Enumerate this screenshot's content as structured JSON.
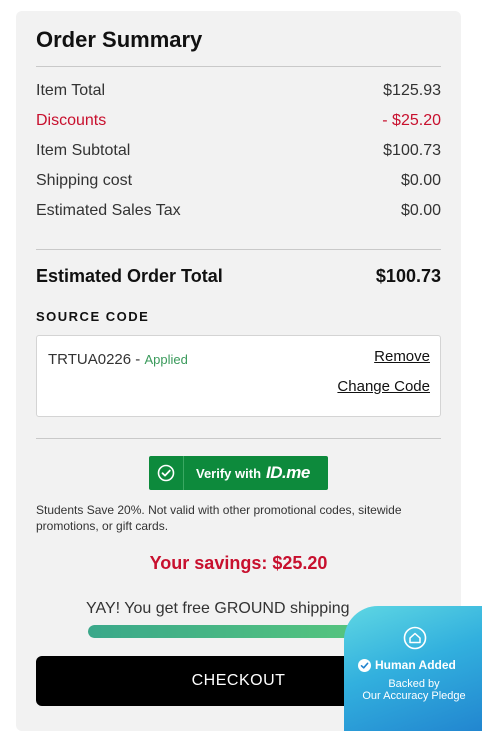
{
  "summary": {
    "title": "Order Summary",
    "rows": [
      {
        "label": "Item Total",
        "value": "$125.93"
      },
      {
        "label": "Discounts",
        "value": "- $25.20"
      },
      {
        "label": "Item Subtotal",
        "value": "$100.73"
      },
      {
        "label": "Shipping cost",
        "value": "$0.00"
      },
      {
        "label": "Estimated Sales Tax",
        "value": "$0.00"
      }
    ],
    "total_label": "Estimated Order Total",
    "total_value": "$100.73"
  },
  "source_code": {
    "heading": "SOURCE CODE",
    "code": "TRTUA0226",
    "separator": " - ",
    "status": "Applied",
    "remove_label": "Remove",
    "change_label": "Change Code"
  },
  "idme": {
    "label": "Verify with",
    "brand": "ID.me",
    "icon": "check-circle-icon"
  },
  "student_note": "Students Save 20%. Not valid with other promotional codes, sitewide promotions, or gift cards.",
  "savings_text": "Your savings: $25.20",
  "shipping": {
    "message": "YAY! You get free GROUND shipping",
    "progress": 1.0
  },
  "checkout_label": "CHECKOUT",
  "badge": {
    "title": "Human Added",
    "line1": "Backed by",
    "line2": "Our Accuracy Pledge",
    "icon": "home-shield-icon"
  },
  "colors": {
    "accent_red": "#c8102e",
    "idme_green": "#0d8a3c",
    "applied_green": "#3a9a5b",
    "checkout_black": "#000000",
    "badge_blue": "#32b0de"
  }
}
